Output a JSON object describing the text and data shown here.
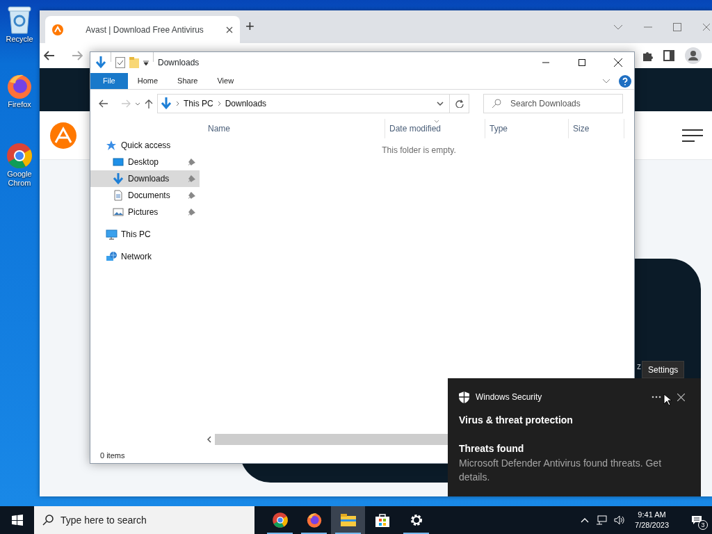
{
  "desktop_icons": [
    {
      "kind": "recycle",
      "label": "Recycle"
    },
    {
      "kind": "firefox",
      "label": "Firefox"
    },
    {
      "kind": "chrome",
      "label": "Google Chrom"
    }
  ],
  "browser": {
    "tab": {
      "title": "Avast | Download Free Antivirus",
      "selected": true
    },
    "new_tab": "+",
    "site": {
      "fragment": "z"
    },
    "tooltip": "Settings"
  },
  "explorer": {
    "title": "Downloads",
    "ribbon_tabs": [
      {
        "label": "File",
        "selected": true
      },
      {
        "label": "Home",
        "selected": false
      },
      {
        "label": "Share",
        "selected": false
      },
      {
        "label": "View",
        "selected": false
      }
    ],
    "breadcrumb": [
      "This PC",
      "Downloads"
    ],
    "search": {
      "placeholder": "Search Downloads"
    },
    "nav": [
      {
        "kind": "star",
        "label": "Quick access",
        "selected": false,
        "children": [
          {
            "kind": "desktop",
            "label": "Desktop",
            "pinned": true,
            "selected": false
          },
          {
            "kind": "download",
            "label": "Downloads",
            "pinned": true,
            "selected": true
          },
          {
            "kind": "documents",
            "label": "Documents",
            "pinned": true,
            "selected": false
          },
          {
            "kind": "pictures",
            "label": "Pictures",
            "pinned": true,
            "selected": false
          }
        ]
      },
      {
        "kind": "pc",
        "label": "This PC",
        "selected": false
      },
      {
        "kind": "network",
        "label": "Network",
        "selected": false
      }
    ],
    "columns": [
      {
        "label": "Name",
        "sorted": false
      },
      {
        "label": "Date modified",
        "sorted": true
      },
      {
        "label": "Type",
        "sorted": false
      },
      {
        "label": "Size",
        "sorted": false
      }
    ],
    "empty_message": "This folder is empty.",
    "status": "0 items"
  },
  "toast": {
    "app": "Windows Security",
    "title": "Virus & threat protection",
    "heading": "Threats found",
    "body": "Microsoft Defender Antivirus found threats. Get details."
  },
  "taskbar": {
    "search": {
      "placeholder": "Type here to search"
    },
    "apps": [
      {
        "kind": "chrome",
        "running": true,
        "active": false
      },
      {
        "kind": "firefox",
        "running": true,
        "active": false
      },
      {
        "kind": "explorer",
        "running": true,
        "active": true
      },
      {
        "kind": "store",
        "running": false,
        "active": false
      },
      {
        "kind": "settings",
        "running": true,
        "active": false
      }
    ],
    "time": "9:41 AM",
    "date": "7/28/2023",
    "notifications": "3"
  }
}
